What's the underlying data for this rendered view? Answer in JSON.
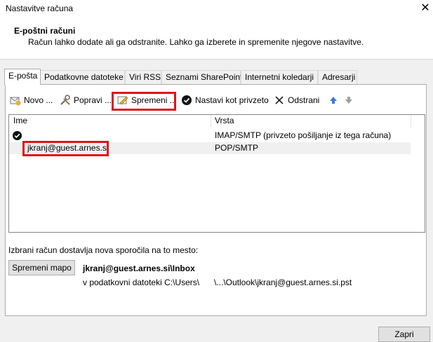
{
  "window": {
    "title": "Nastavitve računa",
    "close_glyph": "✕"
  },
  "header": {
    "title": "E-poštni računi",
    "description": "Račun lahko dodate ali ga odstranite. Lahko ga izberete in spremenite njegove nastavitve."
  },
  "tabs": [
    {
      "label": "E-pošta",
      "active": true
    },
    {
      "label": "Podatkovne datoteke"
    },
    {
      "label": "Viri RSS"
    },
    {
      "label": "Seznami SharePoint"
    },
    {
      "label": "Internetni koledarji"
    },
    {
      "label": "Adresarji"
    }
  ],
  "toolbar": {
    "new_label": "Novo ...",
    "repair_label": "Popravi ...",
    "change_label": "Spremeni ...",
    "default_label": "Nastavi kot privzeto",
    "remove_label": "Odstrani"
  },
  "list": {
    "col_name": "Ime",
    "col_type": "Vrsta",
    "rows": [
      {
        "name": "",
        "type": "IMAP/SMTP (privzeto pošiljanje iz tega računa)",
        "default": true
      },
      {
        "name": "jkranj@guest.arnes.si",
        "type": "POP/SMTP",
        "selected": true
      }
    ]
  },
  "delivery": {
    "label": "Izbrani račun dostavlja nova sporočila na to mesto:",
    "change_folder_label": "Spremeni mapo",
    "folder": "jkranj@guest.arnes.si\\Inbox",
    "path_prefix": "v podatkovni datoteki C:\\Users\\",
    "path_suffix": "\\...\\Outlook\\jkranj@guest.arnes.si.pst"
  },
  "footer": {
    "close_label": "Zapri"
  },
  "colors": {
    "highlight": "#e0121b",
    "arrow_up": "#3c78d8",
    "arrow_down": "#a0a0a0"
  }
}
